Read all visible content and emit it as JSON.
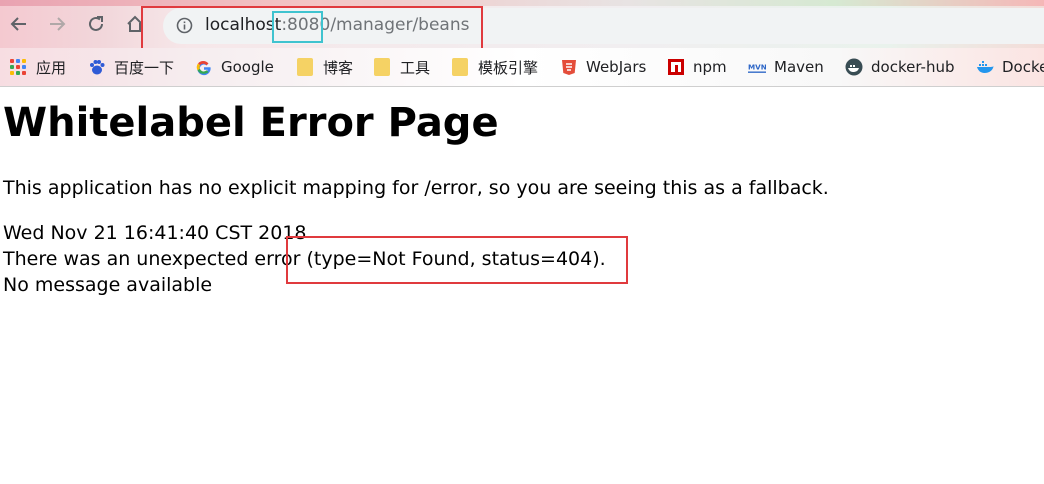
{
  "browser": {
    "url_host": "localhost",
    "url_port": ":8080",
    "url_path": "/manager/beans",
    "bookmarks": [
      {
        "label": "应用",
        "icon": "apps-grid-icon"
      },
      {
        "label": "百度一下",
        "icon": "baidu-paw-icon"
      },
      {
        "label": "Google",
        "icon": "google-icon"
      },
      {
        "label": "博客",
        "icon": "folder-icon"
      },
      {
        "label": "工具",
        "icon": "folder-icon"
      },
      {
        "label": "模板引擎",
        "icon": "folder-icon"
      },
      {
        "label": "WebJars",
        "icon": "webjars-icon"
      },
      {
        "label": "npm",
        "icon": "npm-icon"
      },
      {
        "label": "Maven",
        "icon": "maven-icon"
      },
      {
        "label": "docker-hub",
        "icon": "docker-hub-icon"
      },
      {
        "label": "Docke",
        "icon": "docker-whale-icon"
      }
    ],
    "colors": {
      "highlight_red": "#e03a3e",
      "highlight_teal": "#3fc3cf"
    }
  },
  "page": {
    "title": "Whitelabel Error Page",
    "description": "This application has no explicit mapping for /error, so you are seeing this as a fallback.",
    "timestamp": "Wed Nov 21 16:41:40 CST 2018",
    "error_line": "There was an unexpected error (type=Not Found, status=404).",
    "message": "No message available"
  }
}
